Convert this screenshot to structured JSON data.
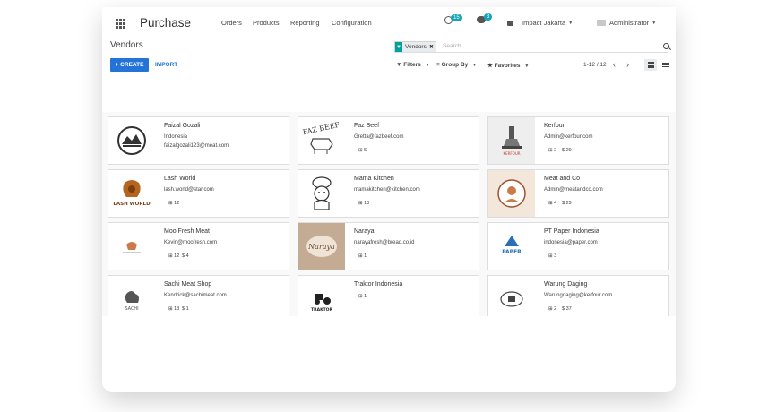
{
  "header": {
    "app_name": "Purchase",
    "menu": [
      "Orders",
      "Products",
      "Reporting",
      "Configuration"
    ],
    "activity_count": "15",
    "message_count": "3",
    "company": "Impact Jakarta",
    "user": "Administrator"
  },
  "control": {
    "title": "Vendors",
    "facet_label": "Vendors",
    "search_placeholder": "Search...",
    "create_label": "+ CREATE",
    "import_label": "IMPORT",
    "filters_label": "Filters",
    "groupby_label": "Group By",
    "favorites_label": "Favorites",
    "pager": "1-12 / 12"
  },
  "colors": {
    "accent": "#2474d8",
    "facet_icon": "#00A09D",
    "badge": "#17a2b8"
  },
  "vendors": [
    {
      "name": "Faizal Gozali",
      "line1": "Indonesia",
      "line2": "faizalgozali123@meat.com",
      "orders": "",
      "amount": "",
      "logo": "house-emblem-icon"
    },
    {
      "name": "Faz Beef",
      "line1": "Gretta@fazbeef.com",
      "line2": "",
      "orders": "5",
      "amount": "",
      "logo": "cow-stamp-icon"
    },
    {
      "name": "Kerfour",
      "line1": "Admin@kerfour.com",
      "line2": "",
      "orders": "2",
      "amount": "$ 29",
      "logo": "temple-icon"
    },
    {
      "name": "Lash World",
      "line1": "lash.world@star.com",
      "line2": "",
      "orders": "12",
      "amount": "",
      "logo": "lash-world-icon"
    },
    {
      "name": "Mama Kitchen",
      "line1": "mamakitchen@kitchen.com",
      "line2": "",
      "orders": "10",
      "amount": "",
      "logo": "chef-icon"
    },
    {
      "name": "Meat and Co",
      "line1": "Admin@meatandco.com",
      "line2": "",
      "orders": "4",
      "amount": "$ 29",
      "logo": "butcher-icon"
    },
    {
      "name": "Moo Fresh Meat",
      "line1": "Kevin@moofresh.com",
      "line2": "",
      "orders": "12",
      "amount": "$ 4",
      "logo": "moo-fresh-icon"
    },
    {
      "name": "Naraya",
      "line1": "narayafresh@bread.co.id",
      "line2": "",
      "orders": "1",
      "amount": "",
      "logo": "naraya-icon"
    },
    {
      "name": "PT Paper Indonesia",
      "line1": "indonesia@paper.com",
      "line2": "",
      "orders": "3",
      "amount": "",
      "logo": "paper-icon"
    },
    {
      "name": "Sachi Meat Shop",
      "line1": "Kendrick@sachimeat.com",
      "line2": "",
      "orders": "13",
      "amount": "$ 1",
      "logo": "rooster-icon"
    },
    {
      "name": "Traktor Indonesia",
      "line1": "",
      "line2": "",
      "orders": "1",
      "amount": "",
      "logo": "tractor-icon"
    },
    {
      "name": "Warung Daging",
      "line1": "Warungdaging@kerfour.com",
      "line2": "",
      "orders": "2",
      "amount": "$ 37",
      "logo": "warung-icon"
    }
  ],
  "logo_text": {
    "faz_beef": "FAZ BEEF",
    "kerfour": "KERFOUR",
    "lash_world": "LASH WORLD",
    "naraya": "Naraya",
    "paper": "PAPER",
    "sachi": "SACHI",
    "traktor": "TRAKTOR"
  }
}
